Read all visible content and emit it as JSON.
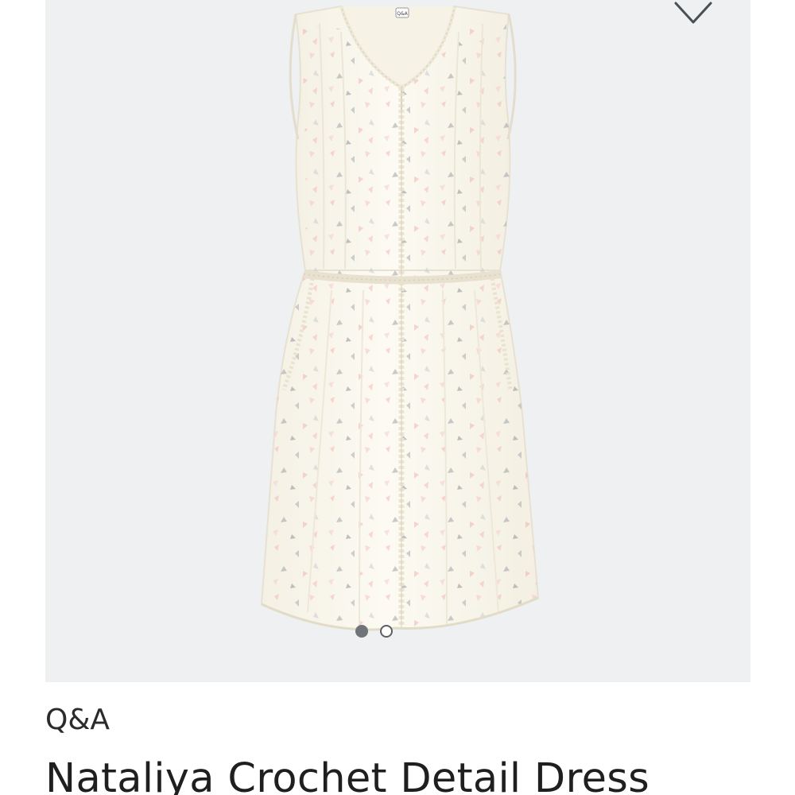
{
  "product": {
    "brand": "Q&A",
    "name": "Nataliya Crochet Detail Dress",
    "tag_label": "Q&A"
  },
  "carousel": {
    "active_index": 1,
    "total": 2
  },
  "icons": {
    "favorite": "heart-outline-icon"
  },
  "colors": {
    "panel_background": "#eff0f1",
    "dress": "#fbf8ee",
    "print_pink": "#f3b8b4",
    "print_gray": "#9a9ea3",
    "dot_active": "#707478"
  }
}
